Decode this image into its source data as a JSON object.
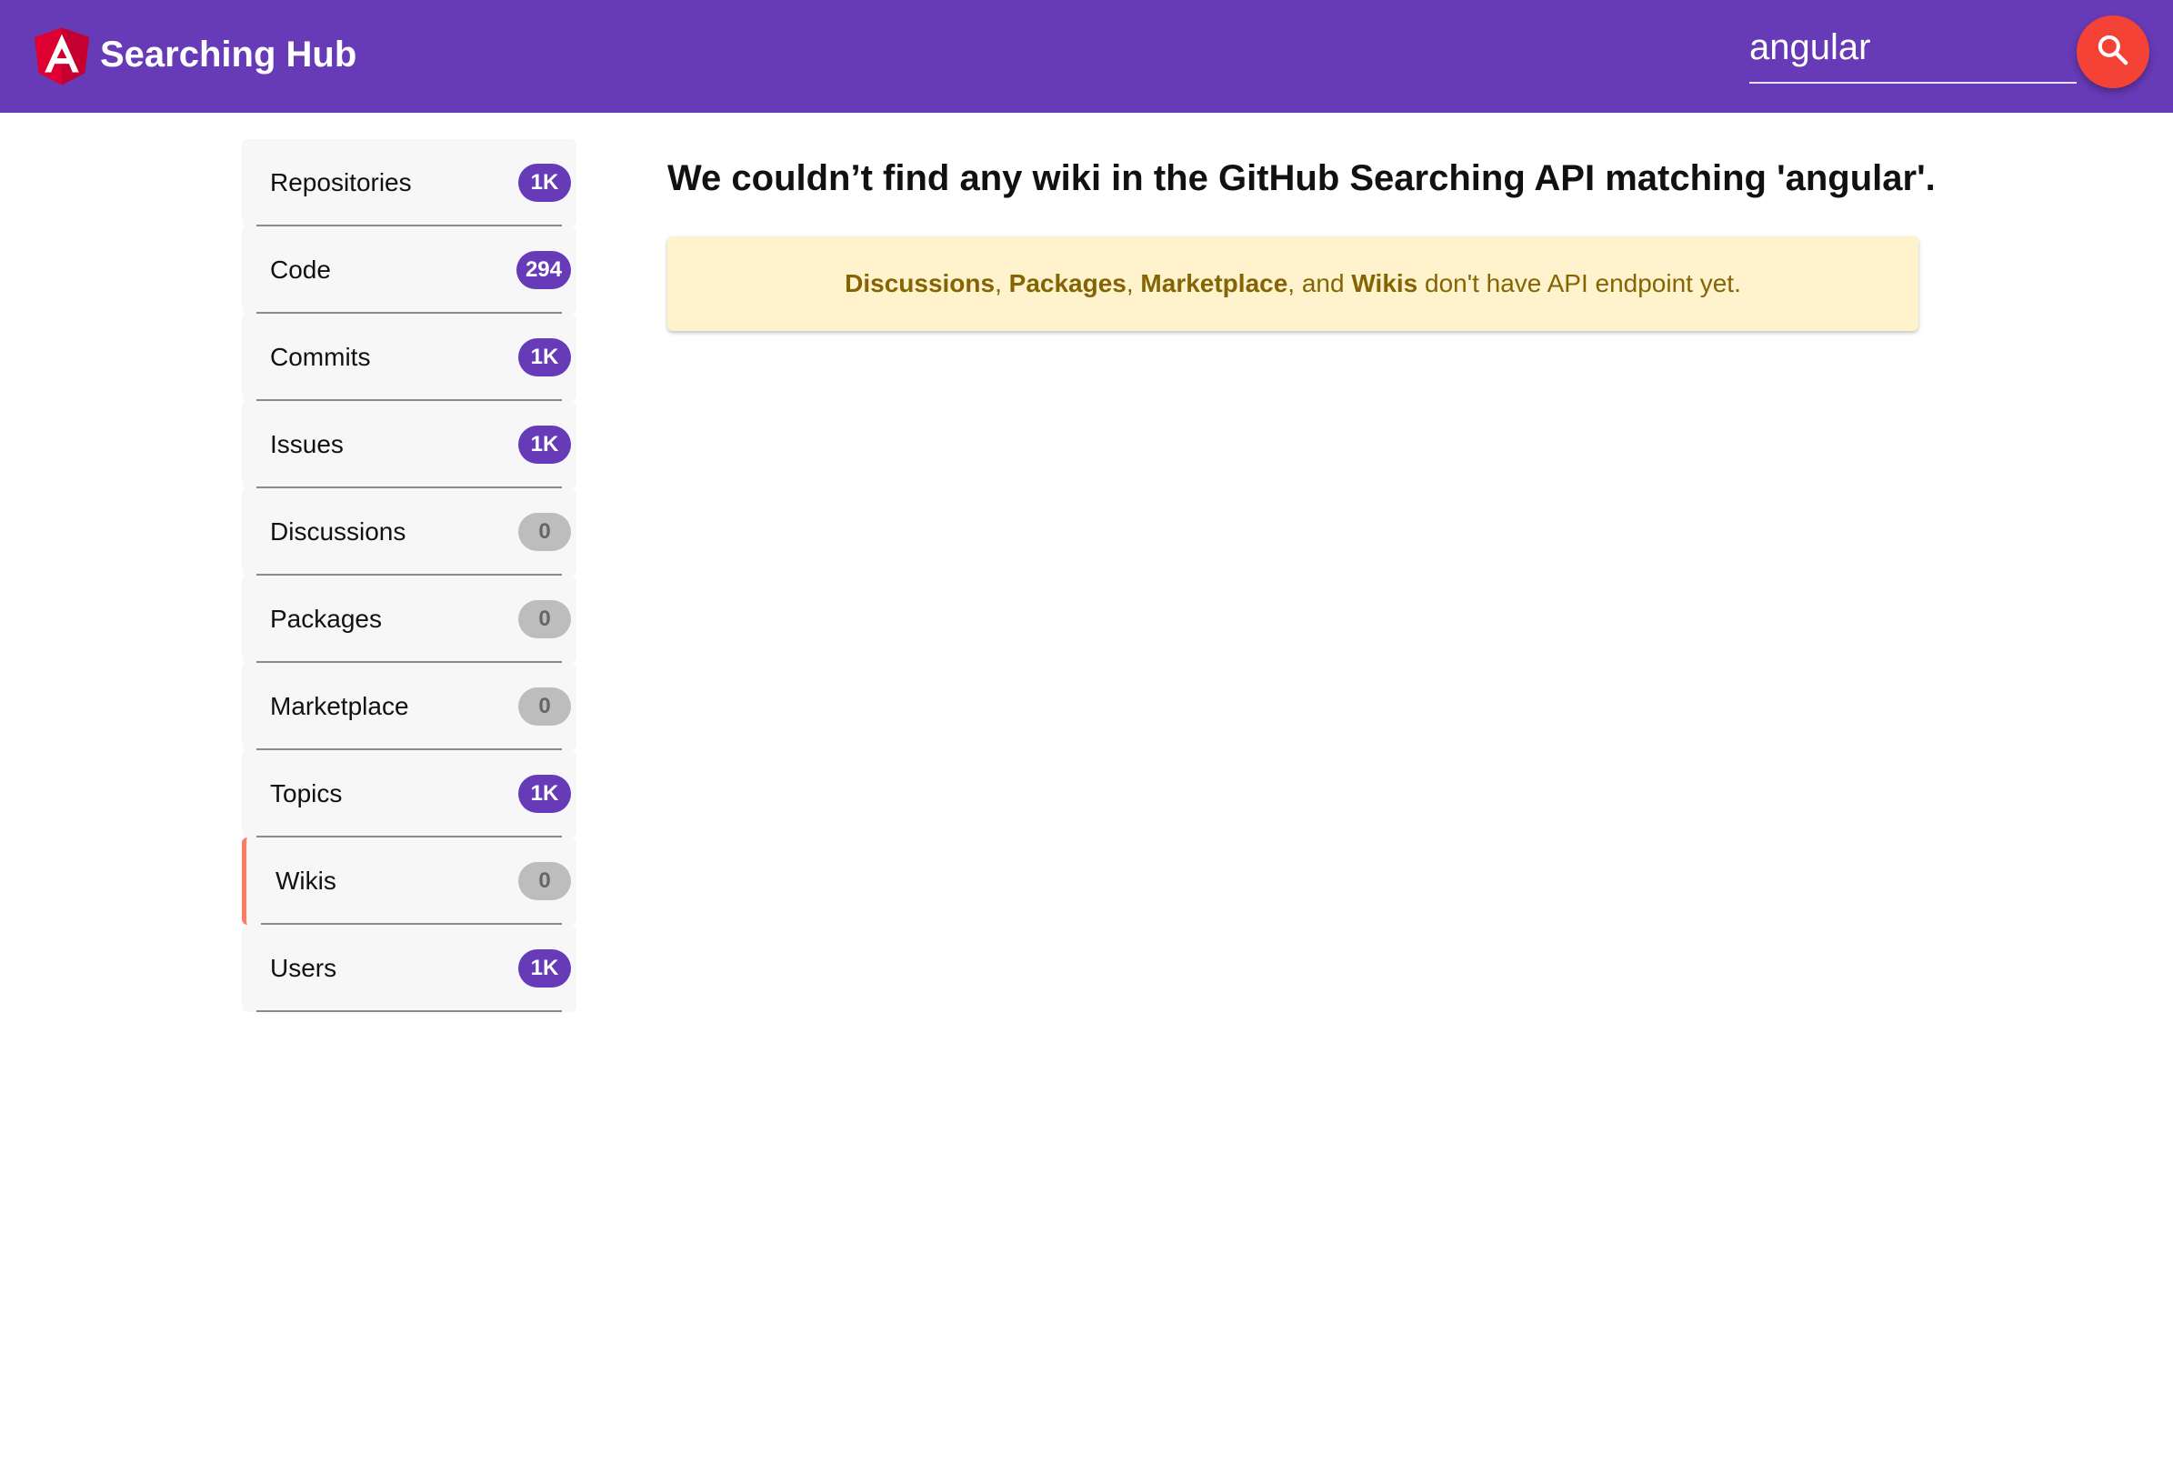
{
  "header": {
    "app_title": "Searching Hub",
    "search_value": "angular",
    "search_placeholder": "",
    "logo_icon": "angular-logo-icon",
    "search_icon": "search-icon",
    "colors": {
      "header_bg": "#673ab7",
      "search_button": "#f44336",
      "logo": "#dd0031"
    }
  },
  "sidebar": {
    "items": [
      {
        "label": "Repositories",
        "count": "1K",
        "badge": "purple",
        "active": false
      },
      {
        "label": "Code",
        "count": "294",
        "badge": "purple",
        "active": false
      },
      {
        "label": "Commits",
        "count": "1K",
        "badge": "purple",
        "active": false
      },
      {
        "label": "Issues",
        "count": "1K",
        "badge": "purple",
        "active": false
      },
      {
        "label": "Discussions",
        "count": "0",
        "badge": "grey",
        "active": false
      },
      {
        "label": "Packages",
        "count": "0",
        "badge": "grey",
        "active": false
      },
      {
        "label": "Marketplace",
        "count": "0",
        "badge": "grey",
        "active": false
      },
      {
        "label": "Topics",
        "count": "1K",
        "badge": "purple",
        "active": false
      },
      {
        "label": "Wikis",
        "count": "0",
        "badge": "grey",
        "active": true
      },
      {
        "label": "Users",
        "count": "1K",
        "badge": "purple",
        "active": false
      }
    ],
    "colors": {
      "active_indicator": "#ff7b63",
      "badge_purple": "#673ab7",
      "badge_grey": "#bdbdbd"
    }
  },
  "main": {
    "title": "We couldn’t find any wiki in the GitHub Searching API matching 'angular'.",
    "notice": {
      "term1": "Discussions",
      "sep1": ", ",
      "term2": "Packages",
      "sep2": ", ",
      "term3": "Marketplace",
      "sep3": ", and ",
      "term4": "Wikis",
      "tail": " don't have API endpoint yet."
    },
    "colors": {
      "notice_bg": "#fff3cd",
      "notice_text": "#856404"
    }
  }
}
